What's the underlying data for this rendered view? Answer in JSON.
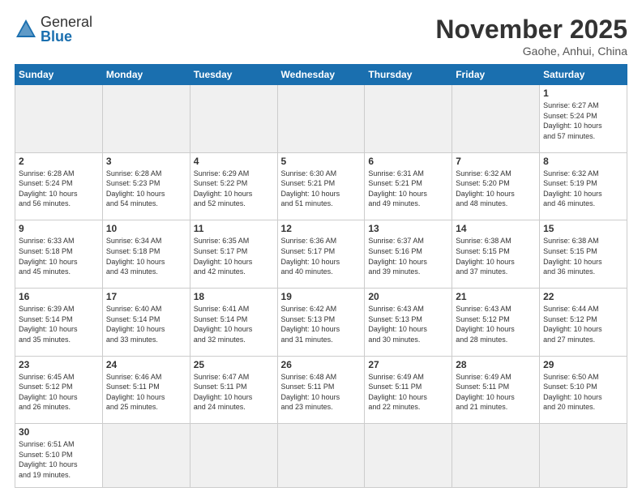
{
  "header": {
    "logo_general": "General",
    "logo_blue": "Blue",
    "month_title": "November 2025",
    "location": "Gaohe, Anhui, China"
  },
  "weekdays": [
    "Sunday",
    "Monday",
    "Tuesday",
    "Wednesday",
    "Thursday",
    "Friday",
    "Saturday"
  ],
  "days": {
    "1": {
      "sunrise": "6:27 AM",
      "sunset": "5:24 PM",
      "daylight": "10 hours and 57 minutes."
    },
    "2": {
      "sunrise": "6:28 AM",
      "sunset": "5:24 PM",
      "daylight": "10 hours and 56 minutes."
    },
    "3": {
      "sunrise": "6:28 AM",
      "sunset": "5:23 PM",
      "daylight": "10 hours and 54 minutes."
    },
    "4": {
      "sunrise": "6:29 AM",
      "sunset": "5:22 PM",
      "daylight": "10 hours and 52 minutes."
    },
    "5": {
      "sunrise": "6:30 AM",
      "sunset": "5:21 PM",
      "daylight": "10 hours and 51 minutes."
    },
    "6": {
      "sunrise": "6:31 AM",
      "sunset": "5:21 PM",
      "daylight": "10 hours and 49 minutes."
    },
    "7": {
      "sunrise": "6:32 AM",
      "sunset": "5:20 PM",
      "daylight": "10 hours and 48 minutes."
    },
    "8": {
      "sunrise": "6:32 AM",
      "sunset": "5:19 PM",
      "daylight": "10 hours and 46 minutes."
    },
    "9": {
      "sunrise": "6:33 AM",
      "sunset": "5:18 PM",
      "daylight": "10 hours and 45 minutes."
    },
    "10": {
      "sunrise": "6:34 AM",
      "sunset": "5:18 PM",
      "daylight": "10 hours and 43 minutes."
    },
    "11": {
      "sunrise": "6:35 AM",
      "sunset": "5:17 PM",
      "daylight": "10 hours and 42 minutes."
    },
    "12": {
      "sunrise": "6:36 AM",
      "sunset": "5:17 PM",
      "daylight": "10 hours and 40 minutes."
    },
    "13": {
      "sunrise": "6:37 AM",
      "sunset": "5:16 PM",
      "daylight": "10 hours and 39 minutes."
    },
    "14": {
      "sunrise": "6:38 AM",
      "sunset": "5:15 PM",
      "daylight": "10 hours and 37 minutes."
    },
    "15": {
      "sunrise": "6:38 AM",
      "sunset": "5:15 PM",
      "daylight": "10 hours and 36 minutes."
    },
    "16": {
      "sunrise": "6:39 AM",
      "sunset": "5:14 PM",
      "daylight": "10 hours and 35 minutes."
    },
    "17": {
      "sunrise": "6:40 AM",
      "sunset": "5:14 PM",
      "daylight": "10 hours and 33 minutes."
    },
    "18": {
      "sunrise": "6:41 AM",
      "sunset": "5:14 PM",
      "daylight": "10 hours and 32 minutes."
    },
    "19": {
      "sunrise": "6:42 AM",
      "sunset": "5:13 PM",
      "daylight": "10 hours and 31 minutes."
    },
    "20": {
      "sunrise": "6:43 AM",
      "sunset": "5:13 PM",
      "daylight": "10 hours and 30 minutes."
    },
    "21": {
      "sunrise": "6:43 AM",
      "sunset": "5:12 PM",
      "daylight": "10 hours and 28 minutes."
    },
    "22": {
      "sunrise": "6:44 AM",
      "sunset": "5:12 PM",
      "daylight": "10 hours and 27 minutes."
    },
    "23": {
      "sunrise": "6:45 AM",
      "sunset": "5:12 PM",
      "daylight": "10 hours and 26 minutes."
    },
    "24": {
      "sunrise": "6:46 AM",
      "sunset": "5:11 PM",
      "daylight": "10 hours and 25 minutes."
    },
    "25": {
      "sunrise": "6:47 AM",
      "sunset": "5:11 PM",
      "daylight": "10 hours and 24 minutes."
    },
    "26": {
      "sunrise": "6:48 AM",
      "sunset": "5:11 PM",
      "daylight": "10 hours and 23 minutes."
    },
    "27": {
      "sunrise": "6:49 AM",
      "sunset": "5:11 PM",
      "daylight": "10 hours and 22 minutes."
    },
    "28": {
      "sunrise": "6:49 AM",
      "sunset": "5:11 PM",
      "daylight": "10 hours and 21 minutes."
    },
    "29": {
      "sunrise": "6:50 AM",
      "sunset": "5:10 PM",
      "daylight": "10 hours and 20 minutes."
    },
    "30": {
      "sunrise": "6:51 AM",
      "sunset": "5:10 PM",
      "daylight": "10 hours and 19 minutes."
    }
  }
}
